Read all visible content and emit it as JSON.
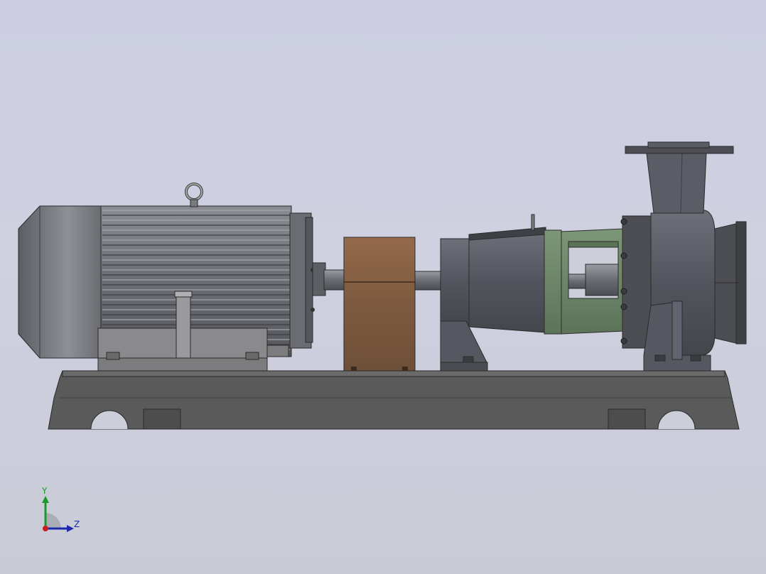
{
  "viewport": {
    "background_top": "#cccde2",
    "background_bottom": "#c9cbd6"
  },
  "model": {
    "colors": {
      "dark_metal": "#4f5157",
      "motor_gray": "#6b6d72",
      "pump_gray": "#55585f",
      "coupling_guard": "#7d5a3f",
      "bracket_green": "#6f8a6a",
      "baseplate": "#5a5a5a"
    }
  },
  "triad": {
    "y_label": "Y",
    "z_label": "Z",
    "colors": {
      "y": "#1a9a2a",
      "z": "#1a2aa8",
      "x": "#c81e1e"
    }
  }
}
